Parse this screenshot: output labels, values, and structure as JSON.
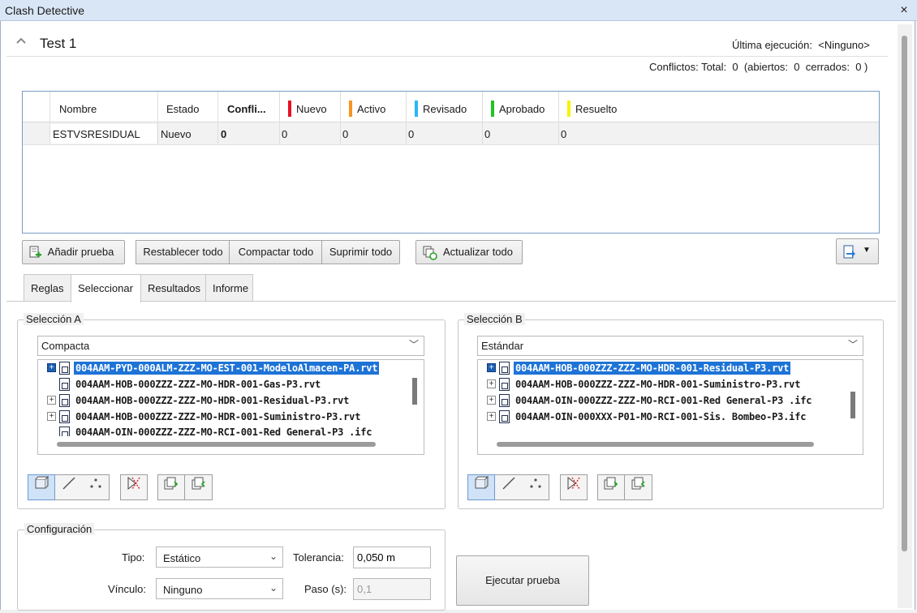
{
  "window": {
    "title": "Clash Detective",
    "close_glyph": "×"
  },
  "test": {
    "name": "Test 1",
    "last_run_label": "Última ejecución:",
    "last_run_value": "<Ninguno>",
    "conflicts_label": "Conflictos: Total:",
    "total": "0",
    "open_label": "(abiertos:",
    "open": "0",
    "closed_label": "cerrados:",
    "closed": "0 )"
  },
  "grid": {
    "headers": {
      "name": "Nombre",
      "state": "Estado",
      "conflicts": "Confli...",
      "new": "Nuevo",
      "active": "Activo",
      "reviewed": "Revisado",
      "approved": "Aprobado",
      "resolved": "Resuelto"
    },
    "row": {
      "name": "ESTVSRESIDUAL",
      "state": "Nuevo",
      "conflicts": "0",
      "new": "0",
      "active": "0",
      "reviewed": "0",
      "approved": "0",
      "resolved": "0"
    },
    "colors": {
      "new": "#e81123",
      "active": "#f7941d",
      "reviewed": "#29b6f6",
      "approved": "#22c322",
      "resolved": "#f4f400"
    }
  },
  "toolbar": {
    "add_test": "Añadir prueba",
    "reset_all": "Restablecer todo",
    "compact_all": "Compactar todo",
    "delete_all": "Suprimir todo",
    "update_all": "Actualizar todo"
  },
  "tabs": [
    "Reglas",
    "Seleccionar",
    "Resultados",
    "Informe"
  ],
  "selection_a": {
    "title": "Selección A",
    "mode": "Compacta",
    "items": [
      "004AAM-PYD-000ALM-ZZZ-MO-EST-001-ModeloAlmacen-PA.rvt",
      "004AAM-HOB-000ZZZ-ZZZ-MO-HDR-001-Gas-P3.rvt",
      "004AAM-HOB-000ZZZ-ZZZ-MO-HDR-001-Residual-P3.rvt",
      "004AAM-HOB-000ZZZ-ZZZ-MO-HDR-001-Suministro-P3.rvt",
      "004AAM-OIN-000ZZZ-ZZZ-MO-RCI-001-Red General-P3 .ifc"
    ]
  },
  "selection_b": {
    "title": "Selección B",
    "mode": "Estándar",
    "items": [
      "004AAM-HOB-000ZZZ-ZZZ-MO-HDR-001-Residual-P3.rvt",
      "004AAM-HOB-000ZZZ-ZZZ-MO-HDR-001-Suministro-P3.rvt",
      "004AAM-OIN-000ZZZ-ZZZ-MO-RCI-001-Red General-P3 .ifc",
      "004AAM-OIN-000XXX-P01-MO-RCI-001-Sis. Bombeo-P3.ifc"
    ]
  },
  "config": {
    "title": "Configuración",
    "type_label": "Tipo:",
    "type_value": "Estático",
    "tolerance_label": "Tolerancia:",
    "tolerance_value": "0,050 m",
    "link_label": "Vínculo:",
    "link_value": "Ninguno",
    "step_label": "Paso (s):",
    "step_value": "0,1"
  },
  "run_button": "Ejecutar prueba"
}
